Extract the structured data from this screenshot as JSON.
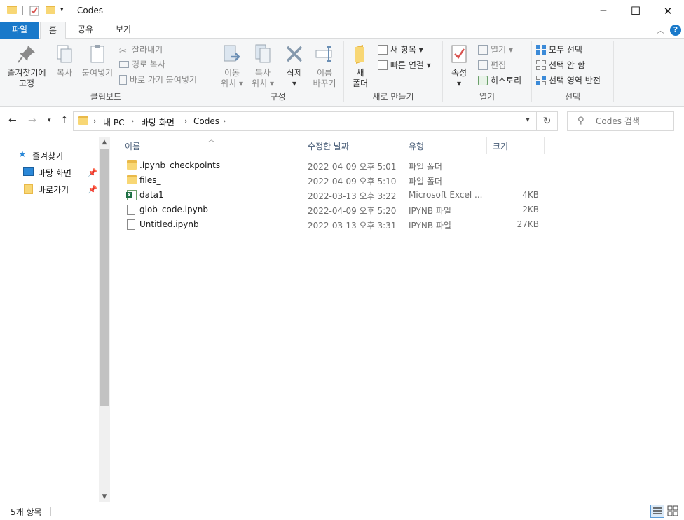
{
  "window": {
    "title": "Codes",
    "minimize": "─",
    "maximize": "☐",
    "close": "✕"
  },
  "ribbon_tabs": [
    {
      "label": "파일"
    },
    {
      "label": "홈"
    },
    {
      "label": "공유"
    },
    {
      "label": "보기"
    }
  ],
  "ribbon": {
    "clipboard": {
      "label": "클립보드",
      "pin_label_1": "즐겨찾기에",
      "pin_label_2": "고정",
      "copy_label": "복사",
      "paste_label": "붙여넣기",
      "cut_label": "잘라내기",
      "copy_path_label": "경로 복사",
      "paste_shortcut_label": "바로 가기 붙여넣기"
    },
    "organize": {
      "label": "구성",
      "move_label_1": "이동",
      "move_label_2": "위치",
      "copyto_label_1": "복사",
      "copyto_label_2": "위치",
      "delete_label": "삭제",
      "rename_label_1": "이름",
      "rename_label_2": "바꾸기"
    },
    "new": {
      "label": "새로 만들기",
      "new_folder_label_1": "새",
      "new_folder_label_2": "폴더",
      "new_item_label": "새 항목",
      "easy_access_label": "빠른 연결"
    },
    "open": {
      "label": "열기",
      "properties_label": "속성",
      "open_label": "열기",
      "edit_label": "편집",
      "history_label": "히스토리"
    },
    "select": {
      "label": "선택",
      "select_all_label": "모두 선택",
      "select_none_label": "선택 안 함",
      "invert_label": "선택 영역 반전"
    }
  },
  "address": {
    "crumbs": [
      "내 PC",
      "바탕 화면",
      "Codes"
    ],
    "search_placeholder": "Codes 검색"
  },
  "nav_pane": {
    "quick_access": "즐겨찾기",
    "items": [
      {
        "label": "바탕 화면",
        "pinned": true
      },
      {
        "label": "바로가기",
        "pinned": true
      }
    ]
  },
  "columns": {
    "name": "이름",
    "modified": "수정한 날짜",
    "type": "유형",
    "size": "크기"
  },
  "files": [
    {
      "name": ".ipynb_checkpoints",
      "modified": "2022-04-09 오후 5:01",
      "type": "파일 폴더",
      "size": "",
      "icon": "folder-icon"
    },
    {
      "name": "files_",
      "modified": "2022-04-09 오후 5:10",
      "type": "파일 폴더",
      "size": "",
      "icon": "folder-icon"
    },
    {
      "name": "data1",
      "modified": "2022-03-13 오후 3:22",
      "type": "Microsoft Excel ...",
      "size": "4KB",
      "icon": "excel-icon"
    },
    {
      "name": "glob_code.ipynb",
      "modified": "2022-04-09 오후 5:20",
      "type": "IPYNB 파일",
      "size": "2KB",
      "icon": "file-icon"
    },
    {
      "name": "Untitled.ipynb",
      "modified": "2022-03-13 오후 3:31",
      "type": "IPYNB 파일",
      "size": "27KB",
      "icon": "file-icon"
    }
  ],
  "status": {
    "item_count": "5개 항목"
  },
  "colors": {
    "accent": "#1979ca",
    "folder": "#f8d775",
    "ribbon_bg": "#f5f6f7"
  }
}
